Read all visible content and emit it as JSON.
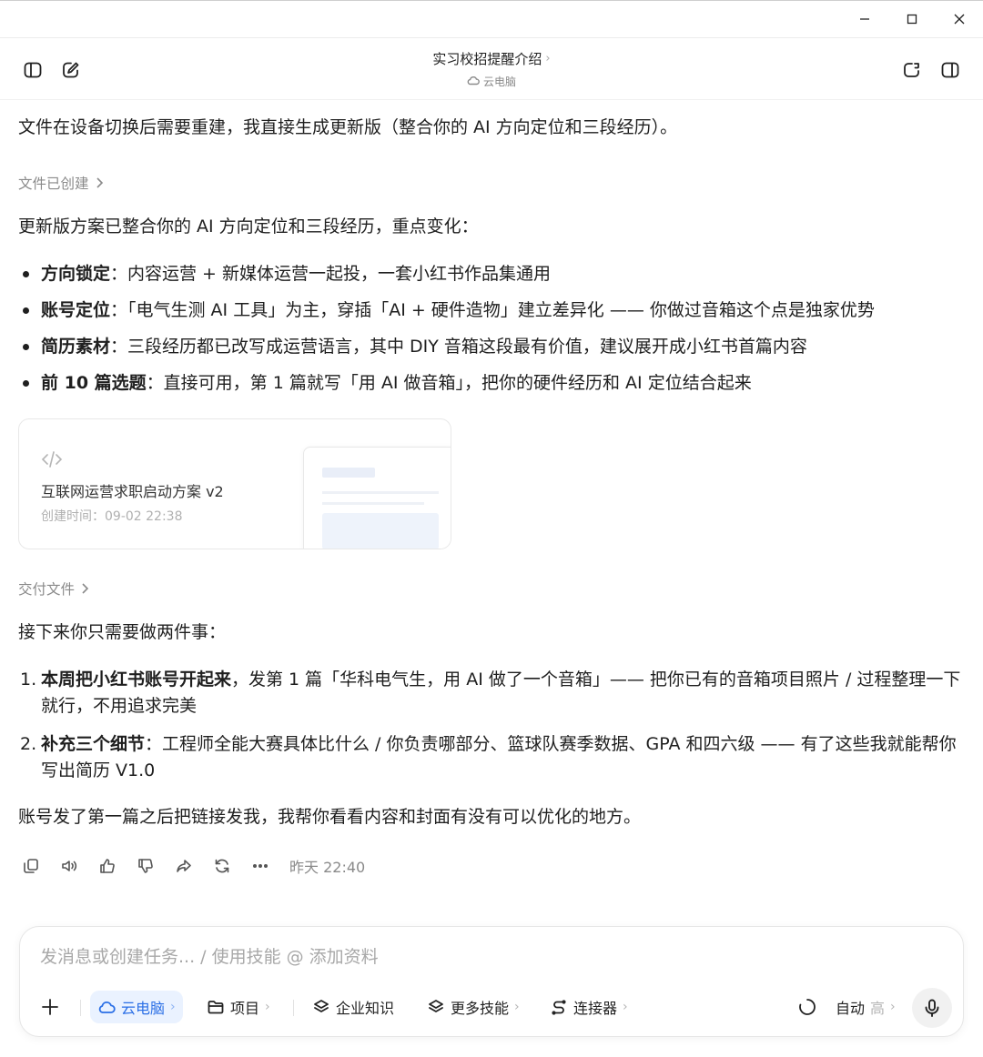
{
  "window": {
    "minimize_icon": "minimize-icon",
    "maximize_icon": "maximize-icon",
    "close_icon": "close-icon"
  },
  "header": {
    "title": "实习校招提醒介绍",
    "title_chevron": "›",
    "subtitle": "云电脑",
    "left_icons": [
      "sidebar-toggle-icon",
      "new-chat-icon"
    ],
    "right_icons": [
      "share-icon",
      "right-panel-icon"
    ]
  },
  "message": {
    "intro": "文件在设备切换后需要重建，我直接生成更新版（整合你的 AI 方向定位和三段经历）。",
    "file_created_label": "文件已创建",
    "summary": "更新版方案已整合你的 AI 方向定位和三段经历，重点变化：",
    "bullets": [
      {
        "bold": "方向锁定",
        "text": "：内容运营 + 新媒体运营一起投，一套小红书作品集通用"
      },
      {
        "bold": "账号定位",
        "text": "：「电气生测 AI 工具」为主，穿插「AI + 硬件造物」建立差异化 —— 你做过音箱这个点是独家优势"
      },
      {
        "bold": "简历素材",
        "text": "：三段经历都已改写成运营语言，其中 DIY 音箱这段最有价值，建议展开成小红书首篇内容"
      },
      {
        "bold": "前 10 篇选题",
        "text": "：直接可用，第 1 篇就写「用 AI 做音箱」，把你的硬件经历和 AI 定位结合起来"
      }
    ],
    "file_card": {
      "icon": "code-icon",
      "title": "互联网运营求职启动方案 v2",
      "created": "创建时间：09-02 22:38"
    },
    "deliver_label": "交付文件",
    "next_intro": "接下来你只需要做两件事：",
    "steps": [
      {
        "num": "1.",
        "bold": "本周把小红书账号开起来",
        "text": "，发第 1 篇「华科电气生，用 AI 做了一个音箱」—— 把你已有的音箱项目照片 / 过程整理一下就行，不用追求完美"
      },
      {
        "num": "2.",
        "bold": "补充三个细节",
        "text": "：工程师全能大赛具体比什么 / 你负责哪部分、篮球队赛季数据、GPA 和四六级 —— 有了这些我就能帮你写出简历 V1.0"
      }
    ],
    "closing": "账号发了第一篇之后把链接发我，我帮你看看内容和封面有没有可以优化的地方。",
    "actions": [
      "copy-icon",
      "speaker-icon",
      "thumbs-up-icon",
      "thumbs-down-icon",
      "share-arrow-icon",
      "regenerate-icon",
      "more-icon"
    ],
    "timestamp": "昨天 22:40"
  },
  "composer": {
    "placeholder": "发消息或创建任务... / 使用技能 @ 添加资料",
    "cloud_label": "云电脑",
    "project_label": "项目",
    "knowledge_label": "企业知识",
    "skills_label": "更多技能",
    "connector_label": "连接器",
    "auto_label": "自动",
    "level_label": "高",
    "chevron": "›",
    "accent_color": "#2a6fe6"
  }
}
